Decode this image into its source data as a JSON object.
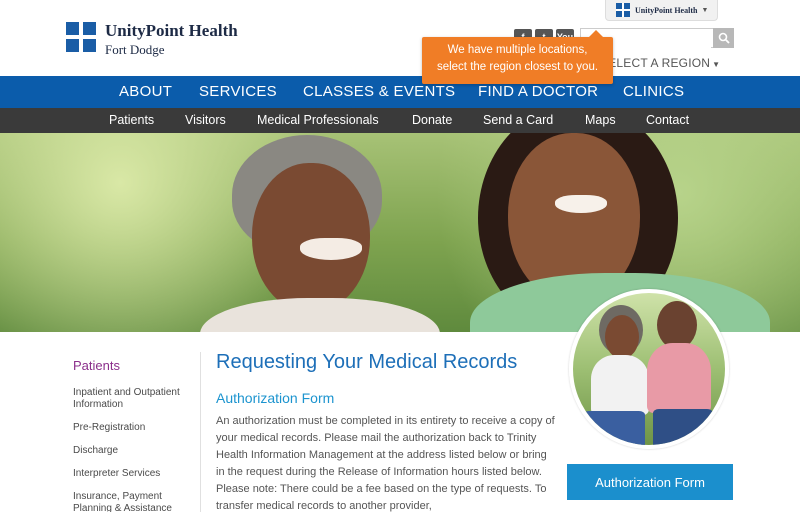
{
  "header": {
    "logo_name": "UnityPoint Health",
    "logo_sub": "Fort Dodge",
    "system_tab_label": "UnityPoint Health",
    "social": [
      {
        "icon": "facebook-icon",
        "glyph": "f"
      },
      {
        "icon": "twitter-icon",
        "glyph": "t"
      },
      {
        "icon": "youtube-icon",
        "glyph": "You"
      }
    ],
    "search_placeholder": "",
    "region_label": "SELECT A REGION",
    "tooltip_text": "We have multiple locations, select the region closest to you."
  },
  "main_nav": [
    "ABOUT",
    "SERVICES",
    "CLASSES & EVENTS",
    "FIND A DOCTOR",
    "CLINICS"
  ],
  "sub_nav": [
    "Patients",
    "Visitors",
    "Medical Professionals",
    "Donate",
    "Send a Card",
    "Maps",
    "Contact"
  ],
  "sidebar": {
    "heading": "Patients",
    "items": [
      "Inpatient and Outpatient Information",
      "Pre-Registration",
      "Discharge",
      "Interpreter Services",
      "Insurance, Payment Planning & Assistance"
    ]
  },
  "content": {
    "title": "Requesting Your Medical Records",
    "subtitle": "Authorization Form",
    "body": "An authorization must be completed in its entirety to receive a copy of your medical records. Please mail the authorization back to Trinity Health Information Management at the address listed below or bring in the request during the Release of Information hours listed below.  Please note: There could be a fee based on the type of requests. To transfer medical records to another provider,"
  },
  "aside": {
    "button_label": "Authorization Form"
  },
  "colors": {
    "brand_blue": "#0b5cab",
    "subnav_dark": "#3a3a3a",
    "tooltip_orange": "#f07d26",
    "sidebar_heading": "#8b2f8b",
    "button_blue": "#1b8fcd"
  }
}
